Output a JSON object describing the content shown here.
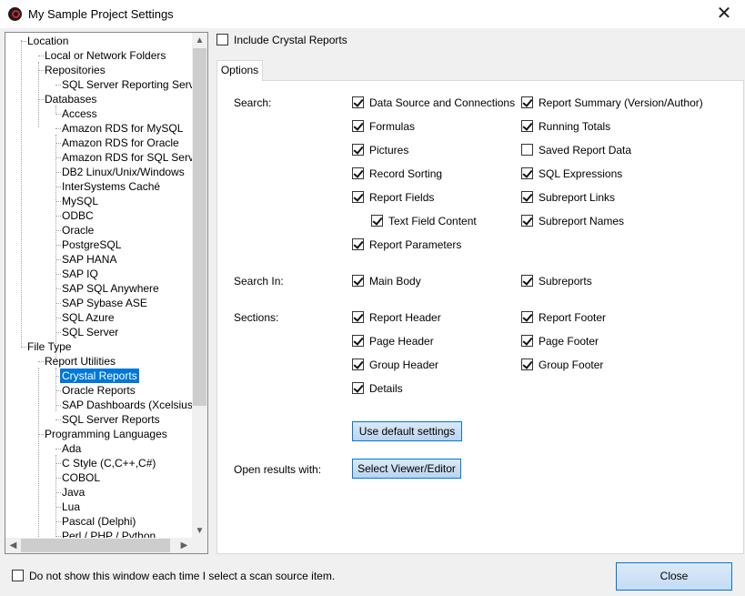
{
  "window": {
    "title": "My Sample Project Settings",
    "close_glyph": "✕"
  },
  "tree": {
    "nodes": [
      {
        "label": "Location"
      },
      {
        "label": "Local or Network Folders"
      },
      {
        "label": "Repositories"
      },
      {
        "label": "SQL Server Reporting Service"
      },
      {
        "label": "Databases"
      },
      {
        "label": "Access"
      },
      {
        "label": "Amazon RDS for MySQL"
      },
      {
        "label": "Amazon RDS for Oracle"
      },
      {
        "label": "Amazon RDS for SQL Server"
      },
      {
        "label": "DB2 Linux/Unix/Windows"
      },
      {
        "label": "InterSystems Caché"
      },
      {
        "label": "MySQL"
      },
      {
        "label": "ODBC"
      },
      {
        "label": "Oracle"
      },
      {
        "label": "PostgreSQL"
      },
      {
        "label": "SAP HANA"
      },
      {
        "label": "SAP IQ"
      },
      {
        "label": "SAP SQL Anywhere"
      },
      {
        "label": "SAP Sybase ASE"
      },
      {
        "label": "SQL Azure"
      },
      {
        "label": "SQL Server"
      },
      {
        "label": "File Type"
      },
      {
        "label": "Report Utilities"
      },
      {
        "label": "Crystal Reports"
      },
      {
        "label": "Oracle Reports"
      },
      {
        "label": "SAP Dashboards (Xcelsius)"
      },
      {
        "label": "SQL Server Reports"
      },
      {
        "label": "Programming Languages"
      },
      {
        "label": "Ada"
      },
      {
        "label": "C Style (C,C++,C#)"
      },
      {
        "label": "COBOL"
      },
      {
        "label": "Java"
      },
      {
        "label": "Lua"
      },
      {
        "label": "Pascal (Delphi)"
      },
      {
        "label": "Perl / PHP / Python"
      }
    ],
    "selected": "Crystal Reports",
    "scroll_up": "▲",
    "scroll_down": "▼",
    "scroll_left": "◀",
    "scroll_right": "▶"
  },
  "include_crystal": {
    "label": "Include Crystal Reports",
    "checked": false
  },
  "tabs": [
    {
      "label": "Options"
    }
  ],
  "options": {
    "search_label": "Search:",
    "search_items": [
      {
        "label": "Data Source and Connections",
        "checked": true
      },
      {
        "label": "Formulas",
        "checked": true
      },
      {
        "label": "Pictures",
        "checked": true
      },
      {
        "label": "Record Sorting",
        "checked": true
      },
      {
        "label": "Report Fields",
        "checked": true
      },
      {
        "label": "Text Field Content",
        "checked": true
      },
      {
        "label": "Report Parameters",
        "checked": true
      },
      {
        "label": "Report Summary (Version/Author)",
        "checked": true
      },
      {
        "label": "Running Totals",
        "checked": true
      },
      {
        "label": "Saved Report Data",
        "checked": false
      },
      {
        "label": "SQL Expressions",
        "checked": true
      },
      {
        "label": "Subreport Links",
        "checked": true
      },
      {
        "label": "Subreport Names",
        "checked": true
      }
    ],
    "search_in_label": "Search In:",
    "search_in_items": [
      {
        "label": "Main Body",
        "checked": true
      },
      {
        "label": "Subreports",
        "checked": true
      }
    ],
    "sections_label": "Sections:",
    "sections_items": [
      {
        "label": "Report Header",
        "checked": true
      },
      {
        "label": "Page Header",
        "checked": true
      },
      {
        "label": "Group Header",
        "checked": true
      },
      {
        "label": "Details",
        "checked": true
      },
      {
        "label": "Report Footer",
        "checked": true
      },
      {
        "label": "Page Footer",
        "checked": true
      },
      {
        "label": "Group Footer",
        "checked": true
      }
    ],
    "default_button": "Use default settings",
    "open_results_label": "Open results with:",
    "viewer_button": "Select Viewer/Editor"
  },
  "footer": {
    "dont_show_label": "Do not show this window each time I select a scan source item.",
    "dont_show_checked": false,
    "close_button": "Close"
  },
  "colors": {
    "selection": "#0078d7",
    "button_border": "#0078d7"
  }
}
